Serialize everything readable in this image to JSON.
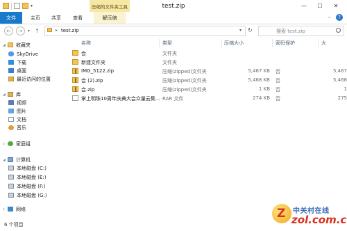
{
  "window": {
    "title": "test.zip",
    "contextual_tool_label": "压缩的文件夹工具",
    "controls": [
      "—",
      "☐",
      "✕"
    ]
  },
  "ribbon": {
    "tabs": {
      "file": "文件",
      "home": "主页",
      "share": "共享",
      "view": "查看",
      "extract": "解压缩"
    },
    "help": "?"
  },
  "nav": {
    "back": "←",
    "forward": "→",
    "dropdown": "▾",
    "up": "↑",
    "path": "test.zip",
    "refresh": "↻",
    "search_placeholder": "搜索 test.zip"
  },
  "sidebar": {
    "favorites": {
      "label": "收藏夹",
      "items": [
        "SkyDrive",
        "下载",
        "桌面",
        "最近访问的位置"
      ]
    },
    "libraries": {
      "label": "库",
      "items": [
        "视频",
        "图片",
        "文档",
        "音乐"
      ]
    },
    "homegroup": "家庭组",
    "computer": {
      "label": "计算机",
      "items": [
        "本地磁盘 (C:)",
        "本地磁盘 (E:)",
        "本地磁盘 (F:)",
        "本地磁盘 (G:)"
      ]
    },
    "network": "网络"
  },
  "columns": {
    "name": "名称",
    "type": "类型",
    "compressed_size": "压缩大小",
    "password": "密码保护",
    "extra": "大"
  },
  "files": [
    {
      "name": "会",
      "type": "文件夹",
      "size": "",
      "pwd": "",
      "extra": "",
      "icon": "folder-icon"
    },
    {
      "name": "新建文件夹",
      "type": "文件夹",
      "size": "",
      "pwd": "",
      "extra": "",
      "icon": "folder-icon"
    },
    {
      "name": "IMG_5122.zip",
      "type": "压缩(zipped)文件夹",
      "size": "5,467 KB",
      "pwd": "否",
      "extra": "5,467",
      "icon": "zip-icon"
    },
    {
      "name": "会 (2).zip",
      "type": "压缩(zipped)文件夹",
      "size": "5,468 KB",
      "pwd": "否",
      "extra": "5,468",
      "icon": "zip-icon"
    },
    {
      "name": "会.zip",
      "type": "压缩(zipped)文件夹",
      "size": "1 KB",
      "pwd": "否",
      "extra": "1",
      "icon": "zip-icon"
    },
    {
      "name": "掌上明珠10周年庆典大会众量云集...",
      "type": "RAR 文件",
      "size": "274 KB",
      "pwd": "否",
      "extra": "275",
      "icon": "rar-icon"
    }
  ],
  "status": {
    "item_count": "6 个项目"
  },
  "watermark": {
    "cn": "中关村在线",
    "en": "zol.com.cn"
  }
}
